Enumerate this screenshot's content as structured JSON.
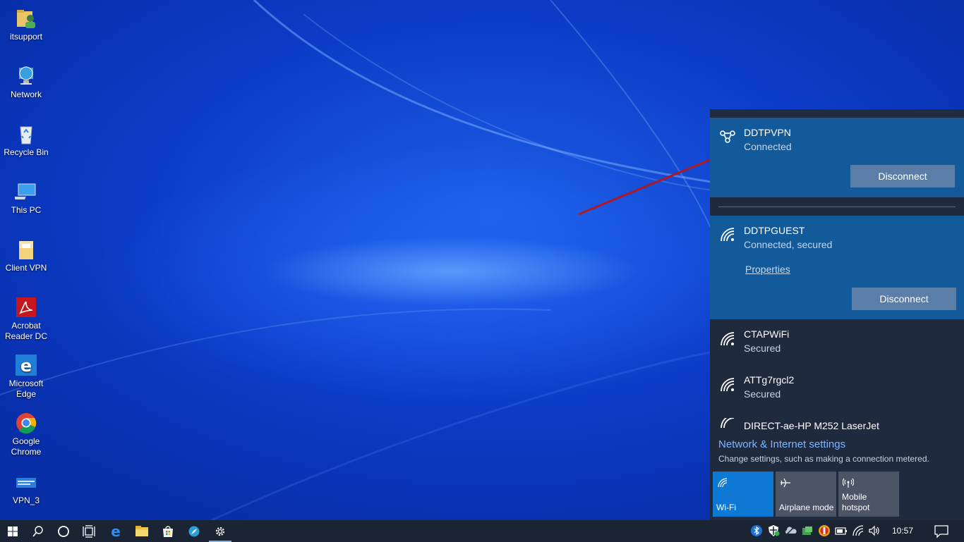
{
  "desktop": {
    "icons": [
      {
        "label": "itsupport",
        "icon": "user-folder-icon"
      },
      {
        "label": "Network",
        "icon": "network-globe-icon"
      },
      {
        "label": "Recycle Bin",
        "icon": "recycle-bin-icon"
      },
      {
        "label": "This PC",
        "icon": "computer-icon"
      },
      {
        "label": "Client VPN",
        "icon": "folder-doc-icon"
      },
      {
        "label": "Acrobat Reader DC",
        "icon": "acrobat-icon"
      },
      {
        "label": "Microsoft Edge",
        "icon": "edge-icon"
      },
      {
        "label": "Google Chrome",
        "icon": "chrome-icon"
      },
      {
        "label": "VPN_3",
        "icon": "vpn-shortcut-icon"
      }
    ]
  },
  "flyout": {
    "vpn": {
      "name": "DDTPVPN",
      "status": "Connected",
      "button": "Disconnect"
    },
    "connected_wifi": {
      "name": "DDTPGUEST",
      "status": "Connected, secured",
      "properties": "Properties",
      "button": "Disconnect"
    },
    "networks": [
      {
        "name": "CTAPWiFi",
        "status": "Secured"
      },
      {
        "name": "ATTg7rgcl2",
        "status": "Secured"
      },
      {
        "name": "DIRECT-ae-HP M252 LaserJet",
        "status": ""
      }
    ],
    "settings_link": "Network & Internet settings",
    "settings_sub": "Change settings, such as making a connection metered.",
    "quick_actions": [
      {
        "label": "Wi-Fi",
        "active": true,
        "icon": "wifi-icon"
      },
      {
        "label": "Airplane mode",
        "active": false,
        "icon": "airplane-icon"
      },
      {
        "label": "Mobile hotspot",
        "active": false,
        "icon": "hotspot-icon"
      }
    ]
  },
  "taskbar": {
    "clock": "10:57 AM",
    "colors": {
      "accent": "#0e78d5",
      "selected": "#135a9b",
      "flyout_bg": "#1f2a3f",
      "taskbar_bg": "#1a2433"
    }
  }
}
